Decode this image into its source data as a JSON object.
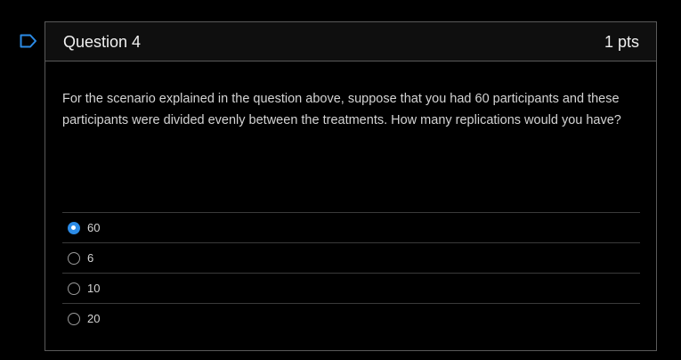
{
  "question": {
    "title": "Question 4",
    "points": "1 pts",
    "text": "For the scenario explained in the question above, suppose that you had 60 participants and these participants were divided evenly between the treatments. How many replications would you have?"
  },
  "answers": [
    {
      "label": "60",
      "selected": true
    },
    {
      "label": "6",
      "selected": false
    },
    {
      "label": "10",
      "selected": false
    },
    {
      "label": "20",
      "selected": false
    }
  ],
  "colors": {
    "selected_radio": "#2b8be6",
    "flag": "#2b8be6",
    "border": "#5a5a5a"
  },
  "icons": {
    "flag": "flag-icon"
  }
}
